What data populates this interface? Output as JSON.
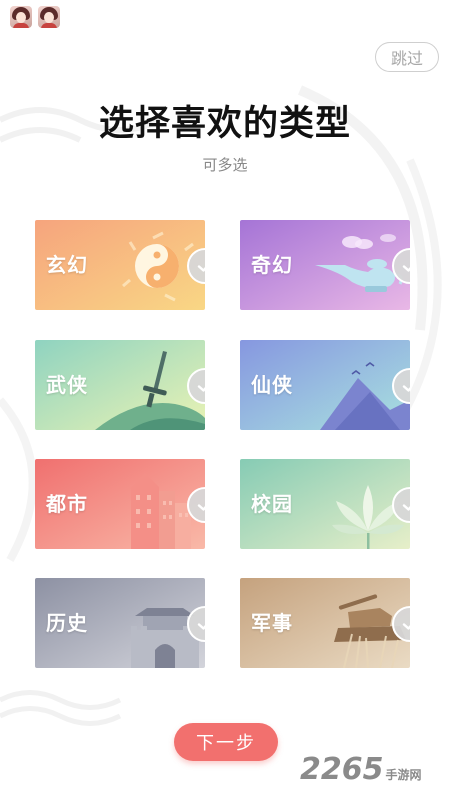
{
  "header": {
    "skip_label": "跳过",
    "title": "选择喜欢的类型",
    "subtitle": "可多选"
  },
  "genres": [
    {
      "label": "玄幻",
      "icon": "yin-yang-icon",
      "selected": false
    },
    {
      "label": "奇幻",
      "icon": "magic-lamp-icon",
      "selected": false
    },
    {
      "label": "武侠",
      "icon": "sword-icon",
      "selected": false
    },
    {
      "label": "仙侠",
      "icon": "mountain-icon",
      "selected": false
    },
    {
      "label": "都市",
      "icon": "city-buildings-icon",
      "selected": false
    },
    {
      "label": "校园",
      "icon": "lotus-icon",
      "selected": false
    },
    {
      "label": "历史",
      "icon": "city-gate-icon",
      "selected": false
    },
    {
      "label": "军事",
      "icon": "tank-icon",
      "selected": false
    }
  ],
  "footer": {
    "next_label": "下一步"
  },
  "watermark": {
    "number": "2265",
    "text": "手游网"
  },
  "colors": {
    "accent": "#f2706e",
    "check": "#d7d7d7"
  }
}
